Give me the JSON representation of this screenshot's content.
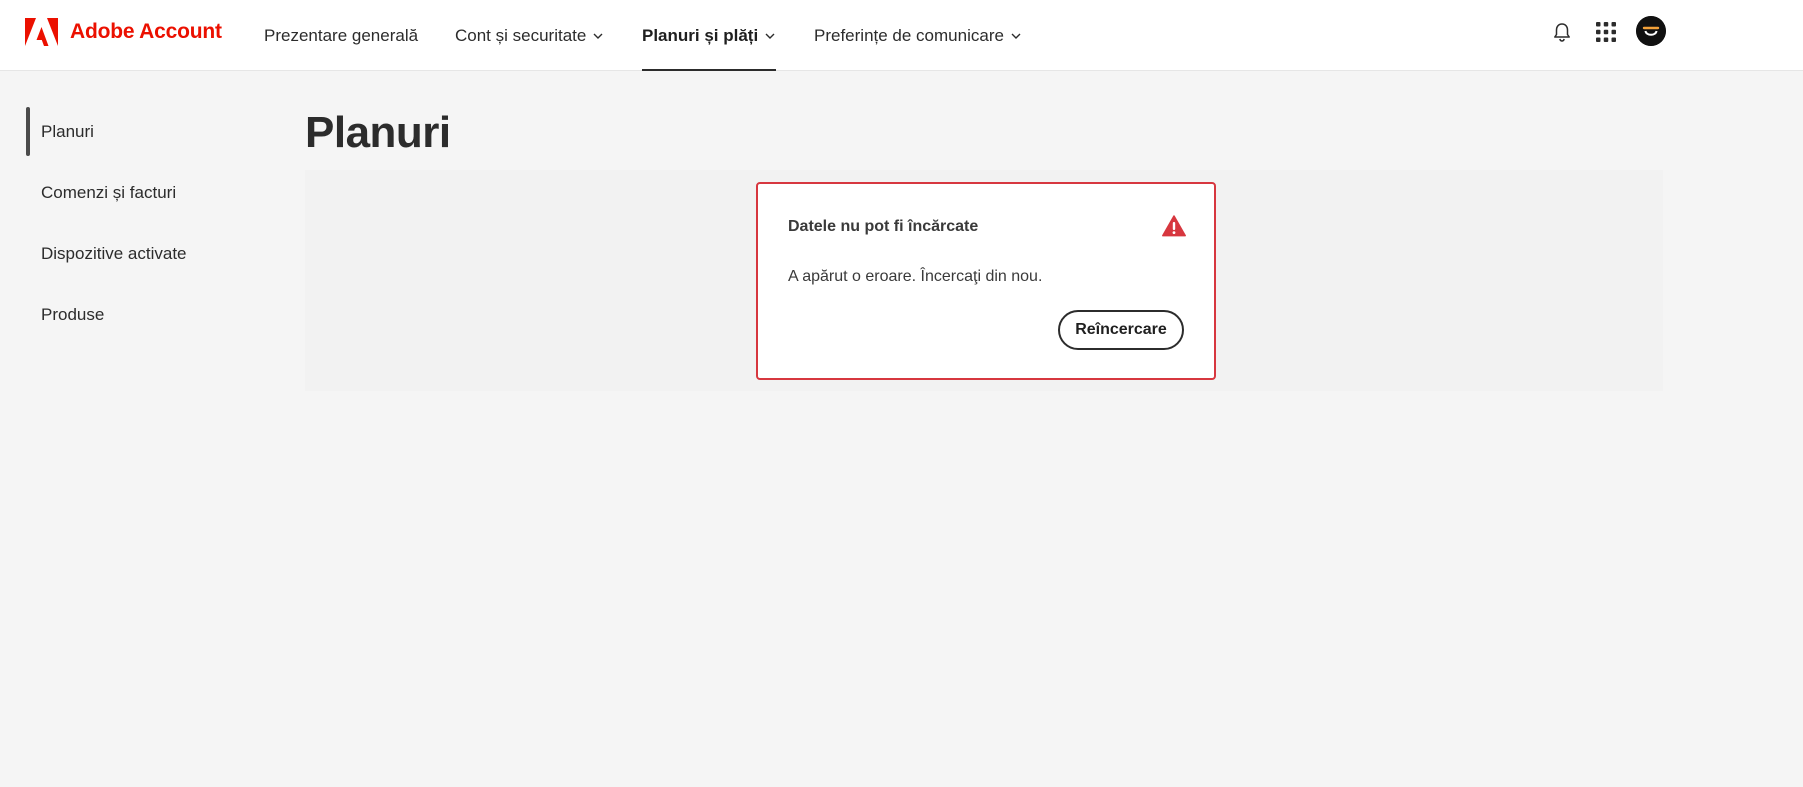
{
  "header": {
    "brand": "Adobe Account",
    "brand_color": "#eb1000",
    "nav": [
      {
        "label": "Prezentare generală",
        "has_dropdown": false,
        "active": false
      },
      {
        "label": "Cont și securitate",
        "has_dropdown": true,
        "active": false
      },
      {
        "label": "Planuri și plăți",
        "has_dropdown": true,
        "active": true
      },
      {
        "label": "Preferințe de comunicare",
        "has_dropdown": true,
        "active": false
      }
    ],
    "icons": [
      "adobe-logo-icon",
      "bell-icon",
      "apps-grid-icon",
      "avatar"
    ]
  },
  "sidebar": {
    "items": [
      {
        "label": "Planuri",
        "active": true
      },
      {
        "label": "Comenzi și facturi",
        "active": false
      },
      {
        "label": "Dispozitive activate",
        "active": false
      },
      {
        "label": "Produse",
        "active": false
      }
    ]
  },
  "main": {
    "title": "Planuri",
    "error": {
      "title": "Datele nu pot fi încărcate",
      "message": "A apărut o eroare. Încercaţi din nou.",
      "retry_label": "Reîncercare",
      "border_color": "#d7373f",
      "icon": "alert-triangle-icon"
    }
  }
}
